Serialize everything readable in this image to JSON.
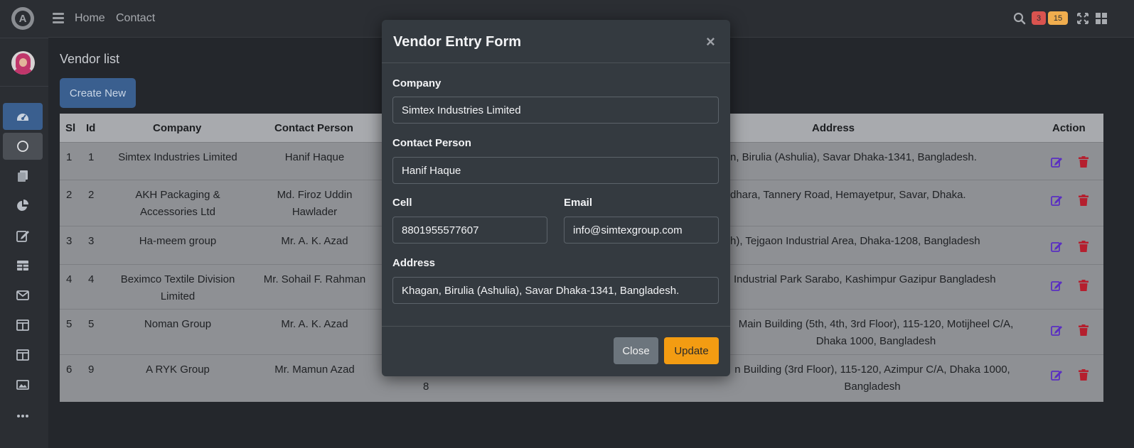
{
  "topbar": {
    "home_label": "Home",
    "contact_label": "Contact",
    "badge_red": "3",
    "badge_yellow": "15",
    "colors": {
      "badge_red": "#d9534f",
      "badge_yellow": "#f0ad4e"
    }
  },
  "sidebar": {
    "logo_letter": "A",
    "items": [
      {
        "icon": "dashboard-icon",
        "state": "active"
      },
      {
        "icon": "circle-icon",
        "state": "hover"
      },
      {
        "icon": "copy-icon"
      },
      {
        "icon": "chart-pie-icon"
      },
      {
        "icon": "edit-icon"
      },
      {
        "icon": "table-icon"
      },
      {
        "icon": "envelope-icon"
      },
      {
        "icon": "columns-icon"
      },
      {
        "icon": "columns-icon"
      },
      {
        "icon": "image-icon"
      },
      {
        "icon": "ellipsis-icon"
      }
    ]
  },
  "page": {
    "title": "Vendor list",
    "create_label": "Create New"
  },
  "table": {
    "headers": {
      "sl": "Sl",
      "id": "Id",
      "company": "Company",
      "contact": "Contact Person",
      "address": "Address",
      "action": "Action"
    },
    "rows": [
      {
        "sl": "1",
        "id": "1",
        "company": "Simtex Industries Limited",
        "contact": "Hanif Haque",
        "address": "n, Birulia (Ashulia), Savar Dhaka-1341, Bangladesh.",
        "extra": ""
      },
      {
        "sl": "2",
        "id": "2",
        "company": "AKH Packaging & Accessories Ltd",
        "contact": "Md. Firoz Uddin Hawlader",
        "address": "dhara, Tannery Road, Hemayetpur, Savar, Dhaka.",
        "extra": ""
      },
      {
        "sl": "3",
        "id": "3",
        "company": "Ha-meem group",
        "contact": "Mr. A. K. Azad",
        "address": "h), Tejgaon Industrial Area, Dhaka-1208, Bangladesh",
        "extra": ""
      },
      {
        "sl": "4",
        "id": "4",
        "company": "Beximco Textile Division Limited",
        "contact": "Mr. Sohail F. Rahman",
        "address": "Industrial Park Sarabo, Kashimpur Gazipur Bangladesh",
        "extra": ""
      },
      {
        "sl": "5",
        "id": "5",
        "company": "Noman Group",
        "contact": "Mr. A. K. Azad",
        "address": "Main Building (5th, 4th, 3rd Floor), 115-120, Motijheel C/A, Dhaka 1000, Bangladesh",
        "extra": ""
      },
      {
        "sl": "6",
        "id": "9",
        "company": "A RYK Group",
        "contact": "Mr. Mamun Azad",
        "address": "n Building (3rd Floor), 115-120, Azimpur C/A, Dhaka 1000, Bangladesh",
        "extra": "8"
      }
    ]
  },
  "modal": {
    "title": "Vendor Entry Form",
    "close_symbol": "×",
    "company_label": "Company",
    "company_value": "Simtex Industries Limited",
    "contact_label": "Contact Person",
    "contact_value": "Hanif Haque",
    "cell_label": "Cell",
    "cell_value": "8801955577607",
    "email_label": "Email",
    "email_value": "info@simtexgroup.com",
    "address_label": "Address",
    "address_value": "Khagan, Birulia (Ashulia), Savar Dhaka-1341, Bangladesh.",
    "close_button": "Close",
    "update_button": "Update"
  }
}
